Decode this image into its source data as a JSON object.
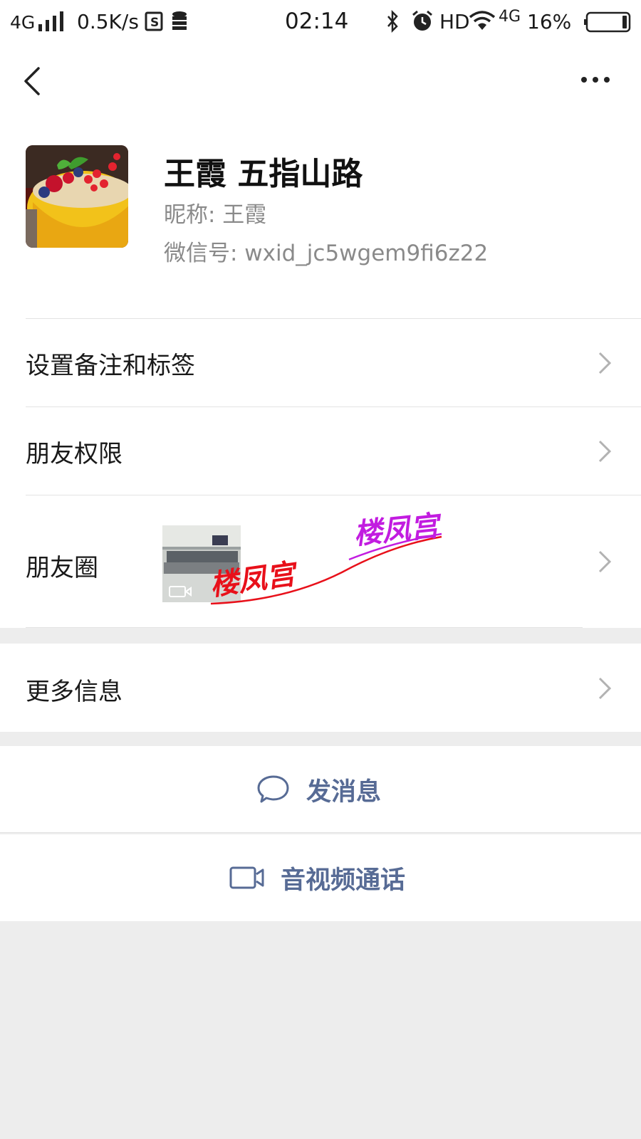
{
  "status_bar": {
    "network": "4G",
    "speed": "0.5K/s",
    "time": "02:14",
    "hd": "HD",
    "network2": "4G",
    "battery": "16%"
  },
  "profile": {
    "remark_name": "王霞 五指山路",
    "nickname_line": "昵称:  王霞",
    "wechat_id_line": "微信号:  wxid_jc5wgem9fi6z22"
  },
  "menu": {
    "remarks_tags": "设置备注和标签",
    "friend_permissions": "朋友权限",
    "moments": "朋友圈",
    "more_info": "更多信息"
  },
  "watermark": {
    "text_1": "楼凤宫",
    "text_2": "楼凤宫"
  },
  "actions": {
    "send_message": "发消息",
    "av_call": "音视频通话"
  },
  "colors": {
    "link_blue": "#576b95",
    "page_bg": "#ededed",
    "watermark_red": "#e8101a",
    "watermark_purple": "#c21ce0"
  }
}
